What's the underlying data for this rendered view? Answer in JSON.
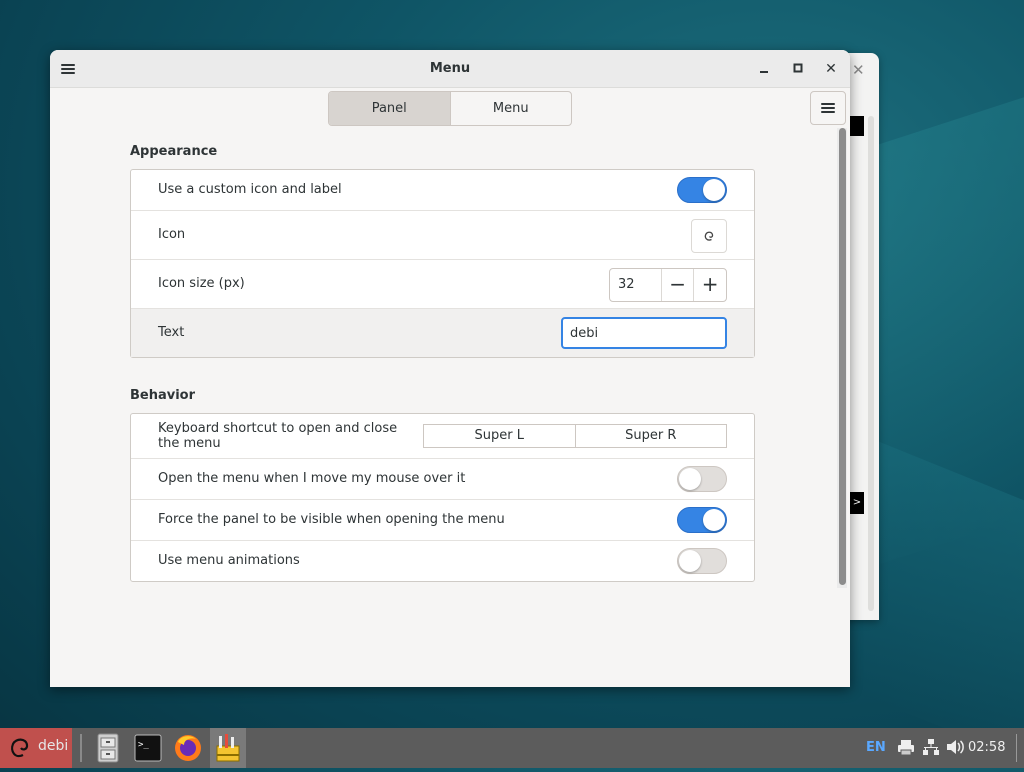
{
  "window": {
    "title": "Menu",
    "tabs": [
      {
        "label": "Panel",
        "active": true
      },
      {
        "label": "Menu",
        "active": false
      }
    ]
  },
  "appearance": {
    "title": "Appearance",
    "custom_icon_label": "Use a custom icon and label",
    "custom_icon_enabled": true,
    "icon_label": "Icon",
    "icon_size_label": "Icon size (px)",
    "icon_size_value": "32",
    "text_label": "Text",
    "text_value": "debi"
  },
  "behavior": {
    "title": "Behavior",
    "shortcut_label": "Keyboard shortcut to open and close the menu",
    "shortcut_keys": [
      "Super L",
      "Super R"
    ],
    "hover_open_label": "Open the menu when I move my mouse over it",
    "hover_open_enabled": false,
    "force_visible_label": "Force the panel to be visible when opening the menu",
    "force_visible_enabled": true,
    "animations_label": "Use menu animations",
    "animations_enabled": false
  },
  "taskbar": {
    "start_label": "debi",
    "apps": [
      "files-icon",
      "terminal-icon",
      "firefox-icon",
      "settings-icon"
    ],
    "keyboard_layout": "EN",
    "time": "02:58"
  },
  "colors": {
    "accent": "#3584e4",
    "start_button": "#c0504d",
    "taskbar": "#5c5c5c"
  }
}
